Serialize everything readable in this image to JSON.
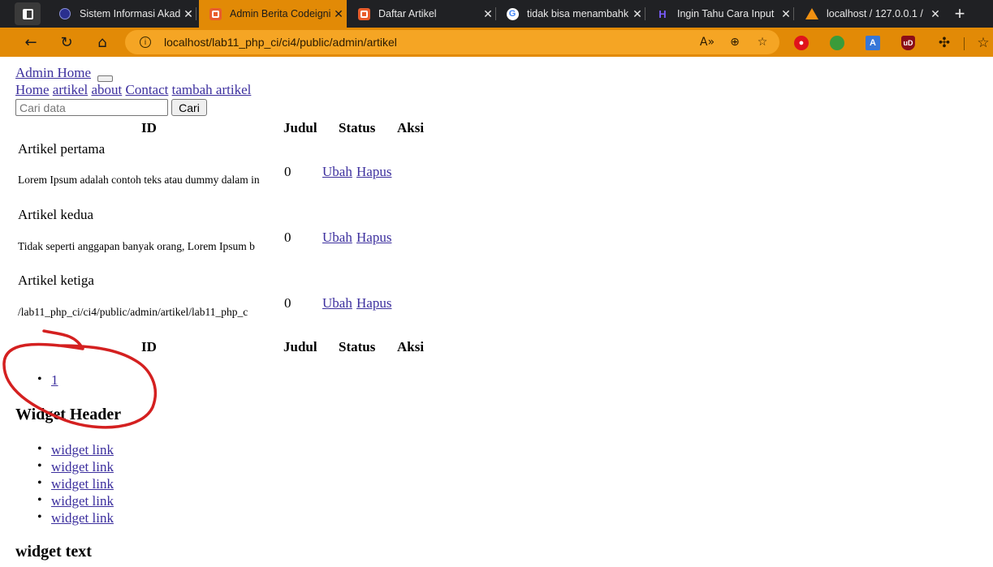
{
  "browser": {
    "tabs": [
      {
        "title": "Sistem Informasi Akad",
        "favicon": "sia-icon",
        "active": false
      },
      {
        "title": "Admin Berita Codeigni",
        "favicon": "codeigniter-icon",
        "active": true
      },
      {
        "title": "Daftar Artikel",
        "favicon": "codeigniter-icon",
        "active": false
      },
      {
        "title": "tidak bisa menambahk",
        "favicon": "google-icon",
        "active": false
      },
      {
        "title": "Ingin Tahu Cara Input",
        "favicon": "hostinger-icon",
        "active": false
      },
      {
        "title": "localhost / 127.0.0.1 /",
        "favicon": "phpmyadmin-icon",
        "active": false
      }
    ],
    "url": "localhost/lab11_php_ci/ci4/public/admin/artikel",
    "accent": "#e28a06"
  },
  "page": {
    "site_title": "Admin Home",
    "nav": [
      "Home",
      "artikel",
      "about",
      "Contact",
      "tambah artikel"
    ],
    "search": {
      "placeholder": "Cari data",
      "button": "Cari"
    },
    "table": {
      "headers": {
        "id": "ID",
        "judul": "Judul",
        "status": "Status",
        "aksi": "Aksi"
      },
      "rows": [
        {
          "title": "Artikel pertama",
          "excerpt": "Lorem Ipsum adalah contoh teks atau dummy dalam in",
          "status": "0",
          "edit": "Ubah",
          "delete": "Hapus"
        },
        {
          "title": "Artikel kedua",
          "excerpt": "Tidak seperti anggapan banyak orang, Lorem Ipsum b",
          "status": "0",
          "edit": "Ubah",
          "delete": "Hapus"
        },
        {
          "title": "Artikel ketiga",
          "excerpt": "/lab11_php_ci/ci4/public/admin/artikel/lab11_php_c",
          "status": "0",
          "edit": "Ubah",
          "delete": "Hapus"
        }
      ]
    },
    "pagination": [
      "1"
    ],
    "widget": {
      "header": "Widget Header",
      "links": [
        "widget link",
        "widget link",
        "widget link",
        "widget link",
        "widget link"
      ],
      "text_title": "widget text"
    },
    "annotation_color": "#d42020"
  }
}
